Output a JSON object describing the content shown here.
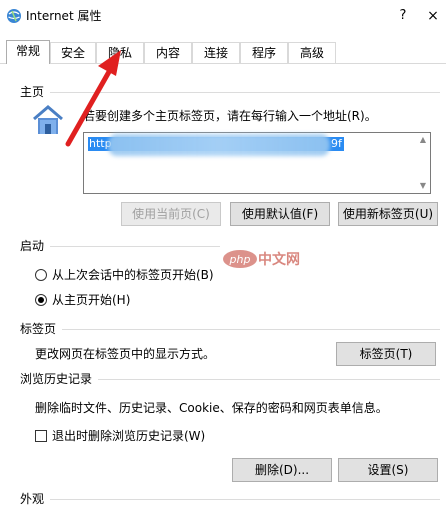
{
  "window": {
    "title": "Internet 属性",
    "help_label": "?",
    "close_label": "×"
  },
  "tabs": [
    {
      "label": "常规",
      "active": true
    },
    {
      "label": "安全",
      "active": false
    },
    {
      "label": "隐私",
      "active": false
    },
    {
      "label": "内容",
      "active": false
    },
    {
      "label": "连接",
      "active": false
    },
    {
      "label": "程序",
      "active": false
    },
    {
      "label": "高级",
      "active": false
    }
  ],
  "home": {
    "section_title": "主页",
    "instruction": "若要创建多个主页标签页，请在每行输入一个地址(R)。",
    "url_start": "http",
    "url_end": "9f",
    "use_current_label": "使用当前页(C)",
    "use_default_label": "使用默认值(F)",
    "use_new_tab_label": "使用新标签页(U)"
  },
  "startup": {
    "section_title": "启动",
    "option_last_session": "从上次会话中的标签页开始(B)",
    "option_home": "从主页开始(H)",
    "selected": "option_home"
  },
  "tabs_section": {
    "section_title": "标签页",
    "description": "更改网页在标签页中的显示方式。",
    "button_label": "标签页(T)"
  },
  "history": {
    "section_title": "浏览历史记录",
    "description": "删除临时文件、历史记录、Cookie、保存的密码和网页表单信息。",
    "checkbox_label": "退出时删除浏览历史记录(W)",
    "checkbox_checked": false,
    "delete_label": "删除(D)...",
    "settings_label": "设置(S)"
  },
  "appearance": {
    "section_title": "外观"
  },
  "watermark": {
    "logo_text": "php",
    "text": "中文网"
  },
  "colors": {
    "selection": "#2a8bf2",
    "annotation_arrow": "#e02020"
  }
}
